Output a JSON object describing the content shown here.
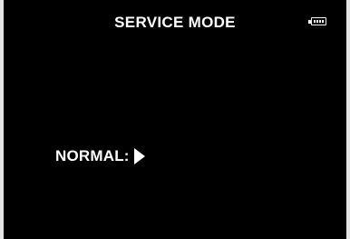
{
  "screen": {
    "title": "SERVICE MODE",
    "mode_label": "NORMAL:",
    "battery_icon": "battery-icon",
    "selector_icon": "play-arrow-icon",
    "battery_level": 1.0
  },
  "colors": {
    "background": "#000000",
    "text": "#ffffff",
    "border": "#e4e4e4"
  }
}
